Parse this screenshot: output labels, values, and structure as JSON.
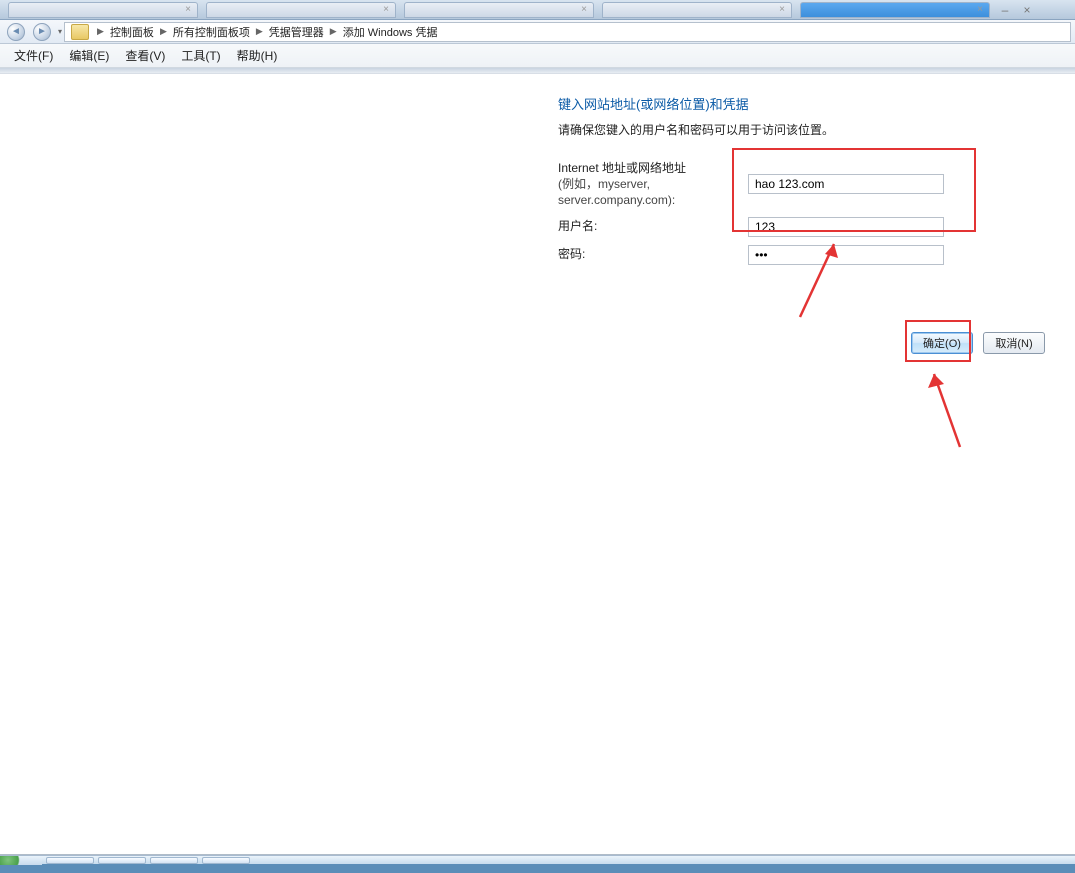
{
  "tabs": [
    {
      "label": ""
    },
    {
      "label": ""
    },
    {
      "label": ""
    },
    {
      "label": ""
    },
    {
      "label": "",
      "active": true
    }
  ],
  "breadcrumb": {
    "items": [
      "控制面板",
      "所有控制面板项",
      "凭据管理器",
      "添加 Windows 凭据"
    ]
  },
  "menu": {
    "file": "文件(F)",
    "edit": "编辑(E)",
    "view": "查看(V)",
    "tools": "工具(T)",
    "help": "帮助(H)"
  },
  "page": {
    "title": "键入网站地址(或网络位置)和凭据",
    "desc": "请确保您键入的用户名和密码可以用于访问该位置。",
    "address_label": "Internet 地址或网络地址",
    "address_example": "(例如，myserver, server.company.com):",
    "username_label": "用户名:",
    "password_label": "密码:"
  },
  "form": {
    "address": "hao 123.com",
    "username": "123",
    "password": "•••"
  },
  "buttons": {
    "ok": "确定(O)",
    "cancel": "取消(N)"
  }
}
